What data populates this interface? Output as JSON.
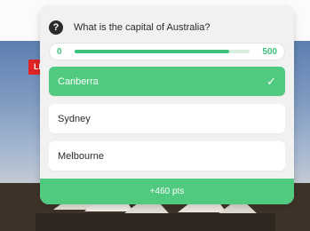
{
  "background": {
    "live_badge": "LI",
    "colors": {
      "sky": "#7d99c0",
      "badge": "#e02424"
    }
  },
  "quiz": {
    "question": "What is the capital of Australia?",
    "question_icon": "question-circle-icon",
    "timer": {
      "min_label": "0",
      "max_label": "500",
      "progress": 0.88
    },
    "options": [
      {
        "label": "Canberra",
        "state": "correct"
      },
      {
        "label": "Sydney",
        "state": "default"
      },
      {
        "label": "Melbourne",
        "state": "default"
      }
    ],
    "check_icon": "checkmark-icon",
    "points": "+460 pts",
    "colors": {
      "accent": "#4fca7f",
      "card": "#f1f1f1"
    }
  }
}
